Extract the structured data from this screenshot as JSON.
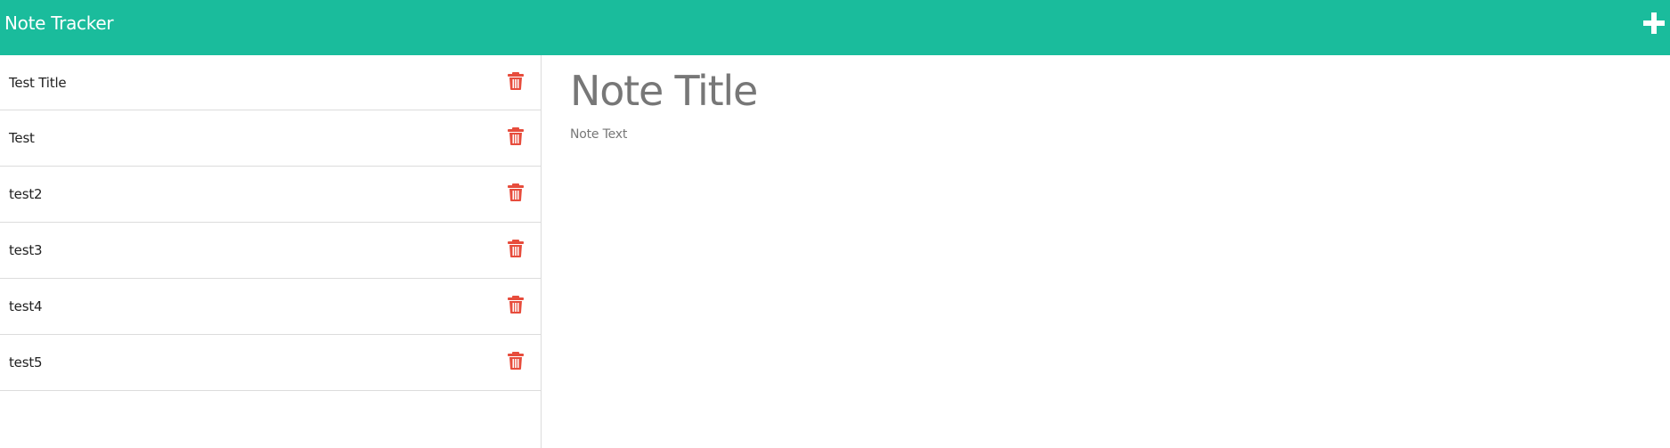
{
  "app": {
    "title": "Note Tracker",
    "add_icon": "plus-icon",
    "brand_color": "#1abc9c",
    "delete_color": "#e74c3c"
  },
  "sidebar": {
    "notes": [
      {
        "label": "Test Title",
        "icon": "trash-icon"
      },
      {
        "label": "Test",
        "icon": "trash-icon"
      },
      {
        "label": "test2",
        "icon": "trash-icon"
      },
      {
        "label": "test3",
        "icon": "trash-icon"
      },
      {
        "label": "test4",
        "icon": "trash-icon"
      },
      {
        "label": "test5",
        "icon": "trash-icon"
      }
    ]
  },
  "editor": {
    "title_placeholder": "Note Title",
    "title_value": "",
    "text_placeholder": "Note Text",
    "text_value": ""
  }
}
